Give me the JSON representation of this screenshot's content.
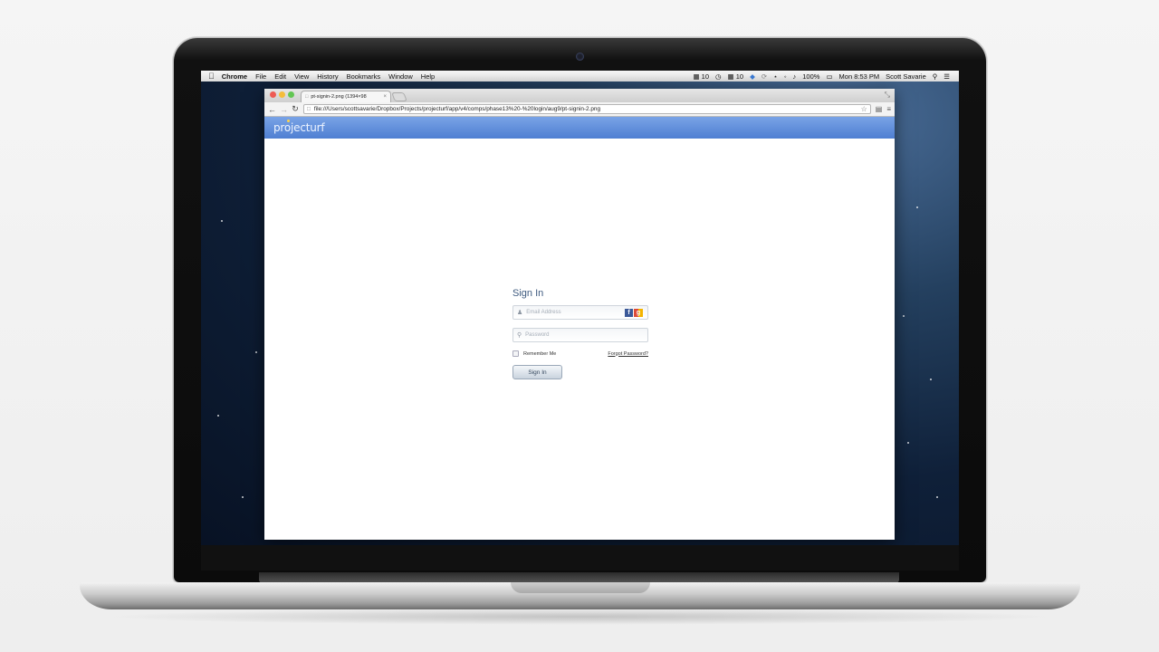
{
  "menubar": {
    "apple_icon": "apple-icon",
    "items": [
      "Chrome",
      "File",
      "Edit",
      "View",
      "History",
      "Bookmarks",
      "Window",
      "Help"
    ],
    "status_a": "10",
    "status_b": "10",
    "battery": "100%",
    "clock": "Mon 8:53 PM",
    "user": "Scott Savarie"
  },
  "browser": {
    "tab_title": "pt-signin-2.png (1394×98",
    "tab_close": "×",
    "url": "file:///Users/scottsavarie/Dropbox/Projects/projecturf/app/v4/comps/phase13%20-%20login/aug9/pt-signin-2.png"
  },
  "site": {
    "logo": "projecturf"
  },
  "signin": {
    "title": "Sign In",
    "email_placeholder": "Email Address",
    "password_placeholder": "Password",
    "facebook_letter": "f",
    "google_letter": "g",
    "remember_label": "Remember Me",
    "forgot_link": "Forgot Password?",
    "submit_label": "Sign In"
  },
  "colors": {
    "brand_bar": "#5b8ad8",
    "title_text": "#3e5a7f",
    "facebook": "#3b5998"
  }
}
